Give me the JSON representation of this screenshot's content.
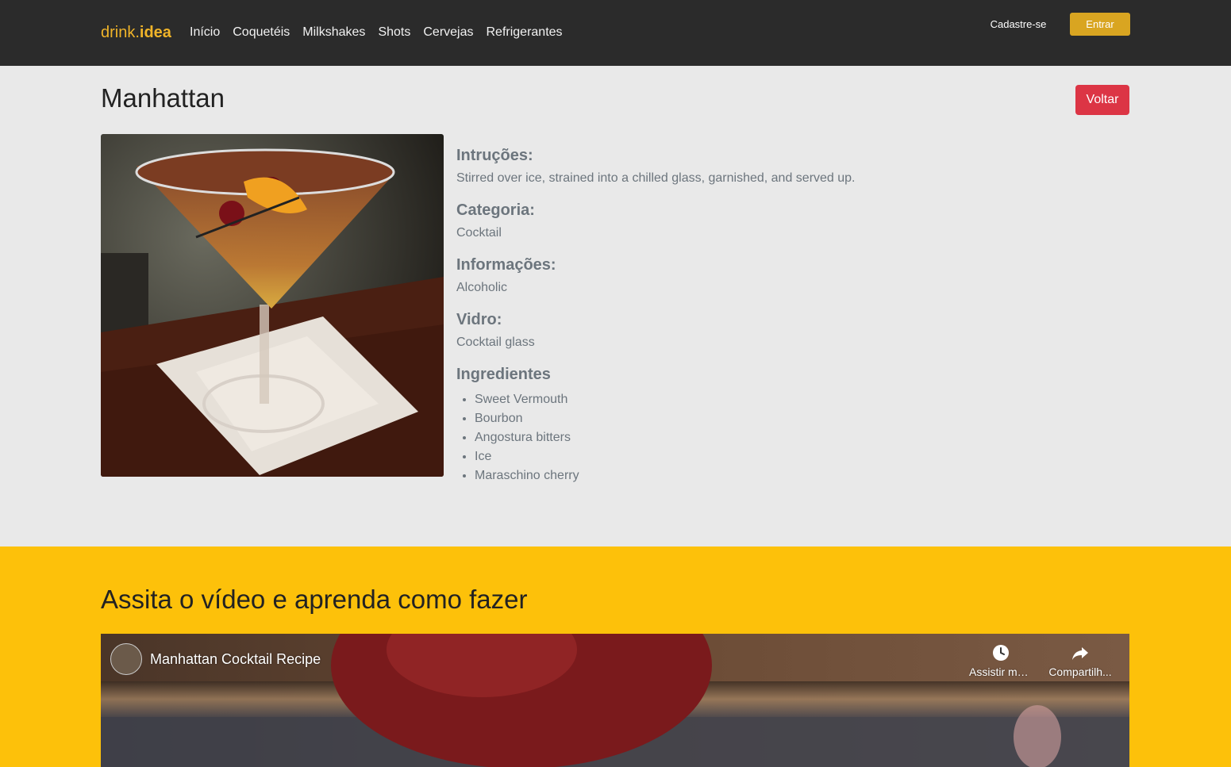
{
  "navbar": {
    "brand_prefix": "drink.",
    "brand_suffix": "idea",
    "links": [
      "Início",
      "Coquetéis",
      "Milkshakes",
      "Shots",
      "Cervejas",
      "Refrigerantes"
    ],
    "signup_label": "Cadastre-se",
    "login_label": "Entrar",
    "colors": {
      "background": "#2b2b2b",
      "brand": "#f0b429",
      "login": "#d9a521"
    }
  },
  "drink": {
    "name": "Manhattan",
    "back_label": "Voltar",
    "back_color": "#dc3545",
    "instructions_label": "Intruções:",
    "instructions": "Stirred over ice, strained into a chilled glass, garnished, and served up.",
    "category_label": "Categoria:",
    "category": "Cocktail",
    "info_label": "Informações:",
    "info": "Alcoholic",
    "glass_label": "Vidro:",
    "glass": "Cocktail glass",
    "ingredients_label": "Ingredientes",
    "ingredients": [
      "Sweet Vermouth",
      "Bourbon",
      "Angostura bitters",
      "Ice",
      "Maraschino cherry"
    ]
  },
  "video": {
    "section_title": "Assita o vídeo e aprenda como fazer",
    "section_color": "#fdc10a",
    "video_title": "Manhattan Cocktail Recipe",
    "watch_later_label": "Assistir ma...",
    "share_label": "Compartilh...",
    "icons": [
      "clock-icon",
      "share-icon"
    ]
  }
}
